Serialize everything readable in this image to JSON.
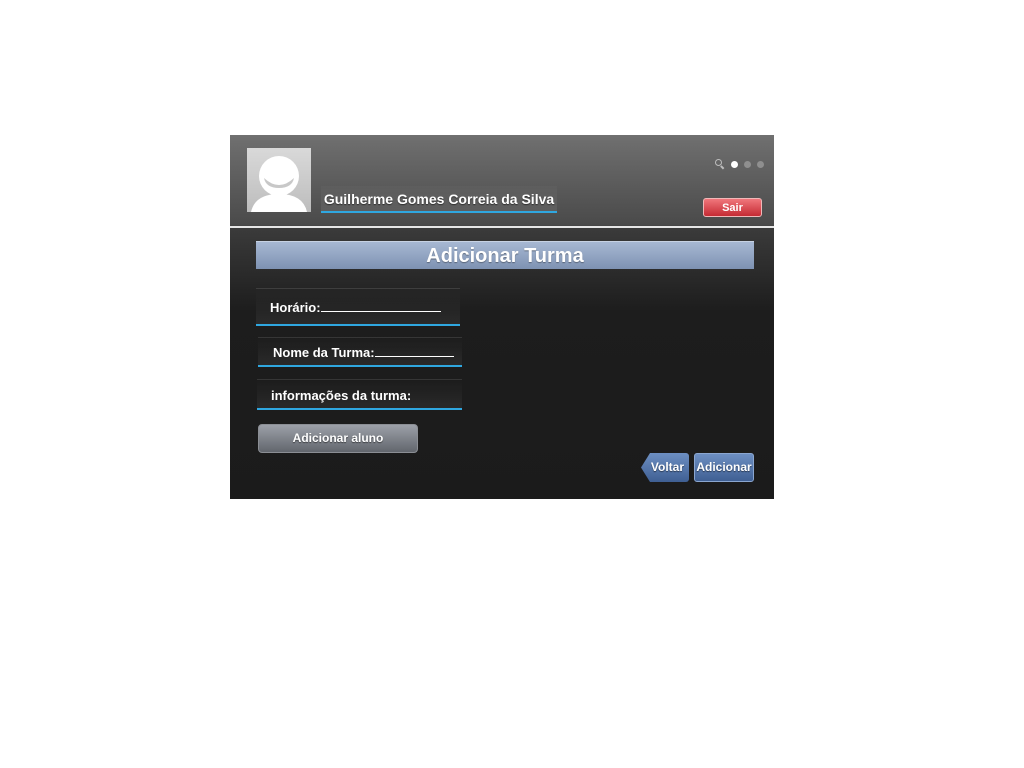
{
  "header": {
    "user_name": "Guilherme Gomes Correia da Silva",
    "logout_label": "Sair",
    "page_indicator": {
      "total_pages": 3,
      "active_page": 1
    }
  },
  "main": {
    "title": "Adicionar Turma",
    "fields": {
      "horario_label": "Horário:",
      "nome_turma_label": "Nome da Turma:",
      "informacoes_label": "informações da turma:"
    },
    "add_student_label": "Adicionar aluno",
    "back_label": "Voltar",
    "submit_label": "Adicionar"
  },
  "colors": {
    "accent_blue": "#2fa7e0",
    "title_bar": "#8fa3c3",
    "logout_red": "#d9434b",
    "nav_blue": "#4f70a5"
  }
}
